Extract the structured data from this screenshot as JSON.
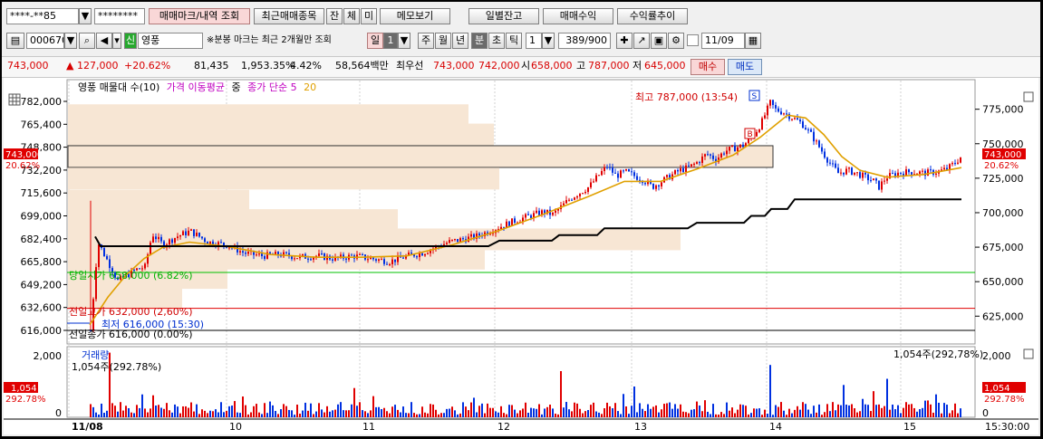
{
  "toolbar1": {
    "account": "****-**85",
    "password": "********",
    "tabs": [
      "매매마크/내역 조회",
      "최근매매종목",
      "잔",
      "체",
      "미",
      "메모보기",
      "일별잔고",
      "매매수익",
      "수익률추이"
    ]
  },
  "toolbar2": {
    "code": "000670",
    "badge": "신",
    "name": "영풍",
    "notice": "※분봉 마크는 최근 2개월만 조회",
    "period_buttons": [
      "일",
      "1",
      "주",
      "월",
      "년",
      "분",
      "초",
      "틱"
    ],
    "interval": "1",
    "count": "389/900",
    "date": "11/09"
  },
  "quote": {
    "price": "743,000",
    "change": "▲ 127,000",
    "change_pct": "+20.62%",
    "volume": "81,435",
    "vol_pct": "1,953.35%",
    "turnover": "4.42%",
    "amount": "58,564백만",
    "lbl_best": "최우선",
    "ask": "743,000",
    "bid": "742,000",
    "lbl_open": "시",
    "open": "658,000",
    "lbl_high": "고",
    "high": "787,000",
    "lbl_low": "저",
    "low": "645,000",
    "buy_label": "매수",
    "sell_label": "매도"
  },
  "legend": {
    "items": [
      {
        "text": "영풍 매물대 수(10)",
        "color": "#000000"
      },
      {
        "text": "가격 이동평균",
        "color": "#c000c0"
      },
      {
        "text": "중",
        "color": "#000000"
      },
      {
        "text": "종가 단순 5",
        "color": "#c000c0"
      },
      {
        "text": "20",
        "color": "#e0a000"
      }
    ]
  },
  "annotations": {
    "high": "최고 787,000 (13:54)",
    "today_open": "당일시가 658,000 (6.82%)",
    "prev_high": "전일고가 632,000 (2,60%)",
    "low": "최저 616,000 (15:30)",
    "prev_close": "전일종가 616,000 (0.00%)",
    "mark_s": "S",
    "mark_b": "B"
  },
  "price_badges": {
    "left_price": "743,000",
    "left_pct": "20.62%",
    "right_price": "743,000",
    "right_pct": "20.62%"
  },
  "volume_panel": {
    "title": "거래량",
    "value_left": "1,054주(292.78%)",
    "value_right": "1,054주(292,78%)",
    "badge_value": "1,054",
    "badge_pct": "292.78%",
    "right_badge_value": "1,054",
    "right_badge_pct": "292.78%"
  },
  "time_current": "15:30:00",
  "colors": {
    "up": "#e00000",
    "down": "#0030e0",
    "ma5": "#e0a000",
    "badge": "#e00000"
  },
  "chart_data": {
    "type": "candlestick",
    "left_axis_ticks": [
      "782,000",
      "765,400",
      "748,800",
      "732,200",
      "715,600",
      "699,000",
      "682,400",
      "665,800",
      "649,200",
      "632,600",
      "616,000"
    ],
    "right_axis_ticks": [
      "775,000",
      "750,000",
      "725,000",
      "700,000",
      "675,000",
      "650,000",
      "625,000"
    ],
    "volume_axis_ticks": [
      "2,000",
      "0"
    ],
    "x_ticks": [
      "11/08",
      "10",
      "11",
      "12",
      "13",
      "14",
      "15"
    ],
    "close_path": [
      [
        0,
        616000
      ],
      [
        8,
        680000
      ],
      [
        30,
        652000
      ],
      [
        50,
        660000
      ],
      [
        60,
        662000
      ],
      [
        68,
        686000
      ],
      [
        80,
        678000
      ],
      [
        95,
        684000
      ],
      [
        110,
        688000
      ],
      [
        130,
        680000
      ],
      [
        150,
        678000
      ],
      [
        170,
        672000
      ],
      [
        190,
        670000
      ],
      [
        210,
        671000
      ],
      [
        230,
        669000
      ],
      [
        250,
        670000
      ],
      [
        270,
        668000
      ],
      [
        290,
        670000
      ],
      [
        310,
        668000
      ],
      [
        330,
        666000
      ],
      [
        350,
        670000
      ],
      [
        365,
        672000
      ],
      [
        380,
        676000
      ],
      [
        395,
        680000
      ],
      [
        410,
        682000
      ],
      [
        425,
        684000
      ],
      [
        440,
        688000
      ],
      [
        455,
        692000
      ],
      [
        470,
        696000
      ],
      [
        485,
        699000
      ],
      [
        500,
        702000
      ],
      [
        510,
        700000
      ],
      [
        520,
        706000
      ],
      [
        530,
        712000
      ],
      [
        540,
        716000
      ],
      [
        550,
        720000
      ],
      [
        560,
        728000
      ],
      [
        570,
        735000
      ],
      [
        580,
        728000
      ],
      [
        590,
        731000
      ],
      [
        600,
        728000
      ],
      [
        610,
        725000
      ],
      [
        620,
        720000
      ],
      [
        630,
        724000
      ],
      [
        640,
        728000
      ],
      [
        650,
        732000
      ],
      [
        660,
        734000
      ],
      [
        670,
        738000
      ],
      [
        680,
        744000
      ],
      [
        690,
        740000
      ],
      [
        700,
        746000
      ],
      [
        710,
        748000
      ],
      [
        720,
        750000
      ],
      [
        730,
        756000
      ],
      [
        740,
        766000
      ],
      [
        746,
        775000
      ],
      [
        750,
        781000
      ],
      [
        756,
        776000
      ],
      [
        765,
        774000
      ],
      [
        775,
        770000
      ],
      [
        785,
        766000
      ],
      [
        795,
        758000
      ],
      [
        805,
        748000
      ],
      [
        815,
        738000
      ],
      [
        825,
        730000
      ],
      [
        835,
        732000
      ],
      [
        845,
        730000
      ],
      [
        855,
        727000
      ],
      [
        865,
        724000
      ],
      [
        870,
        720000
      ],
      [
        878,
        727000
      ],
      [
        890,
        730000
      ],
      [
        905,
        731000
      ],
      [
        920,
        730000
      ],
      [
        935,
        731000
      ],
      [
        945,
        733000
      ],
      [
        955,
        738000
      ],
      [
        962,
        743000
      ]
    ],
    "ma_line": [
      [
        0,
        620000
      ],
      [
        20,
        640000
      ],
      [
        40,
        656000
      ],
      [
        60,
        668000
      ],
      [
        80,
        676000
      ],
      [
        110,
        680000
      ],
      [
        150,
        677000
      ],
      [
        200,
        671000
      ],
      [
        250,
        669000
      ],
      [
        300,
        669000
      ],
      [
        350,
        670000
      ],
      [
        400,
        678000
      ],
      [
        450,
        688000
      ],
      [
        500,
        700000
      ],
      [
        550,
        713000
      ],
      [
        590,
        724000
      ],
      [
        630,
        724000
      ],
      [
        670,
        733000
      ],
      [
        710,
        743000
      ],
      [
        740,
        756000
      ],
      [
        770,
        772000
      ],
      [
        790,
        770000
      ],
      [
        810,
        758000
      ],
      [
        830,
        742000
      ],
      [
        850,
        732000
      ],
      [
        880,
        727000
      ],
      [
        920,
        729000
      ],
      [
        962,
        734000
      ]
    ],
    "black_step": [
      [
        6,
        684000
      ],
      [
        12,
        677000
      ],
      [
        380,
        677000
      ],
      [
        440,
        677000
      ],
      [
        452,
        681000
      ],
      [
        480,
        681000
      ],
      [
        510,
        681000
      ],
      [
        518,
        685000
      ],
      [
        560,
        685000
      ],
      [
        568,
        690000
      ],
      [
        660,
        690000
      ],
      [
        670,
        694000
      ],
      [
        722,
        694000
      ],
      [
        730,
        699000
      ],
      [
        745,
        699000
      ],
      [
        752,
        704000
      ],
      [
        770,
        704000
      ],
      [
        778,
        711000
      ],
      [
        962,
        711000
      ]
    ],
    "volume_profile": [
      {
        "price": 772000,
        "len": 442
      },
      {
        "price": 758000,
        "len": 470
      },
      {
        "price": 742000,
        "len": 778
      },
      {
        "price": 726000,
        "len": 476
      },
      {
        "price": 710000,
        "len": 200
      },
      {
        "price": 696000,
        "len": 364
      },
      {
        "price": 682000,
        "len": 676
      },
      {
        "price": 668000,
        "len": 460
      },
      {
        "price": 654000,
        "len": 176
      },
      {
        "price": 640000,
        "len": 126
      }
    ],
    "ref_lines": [
      {
        "price": 658000,
        "color": "#00c000"
      },
      {
        "price": 632000,
        "color": "#e00000"
      },
      {
        "price": 616000,
        "color": "#000000"
      }
    ],
    "volume_spikes": [
      [
        22,
        2100
      ],
      [
        290,
        950
      ],
      [
        520,
        1500
      ],
      [
        600,
        1000
      ],
      [
        750,
        1700
      ],
      [
        830,
        1050
      ],
      [
        880,
        1250
      ],
      [
        962,
        1054
      ]
    ]
  }
}
